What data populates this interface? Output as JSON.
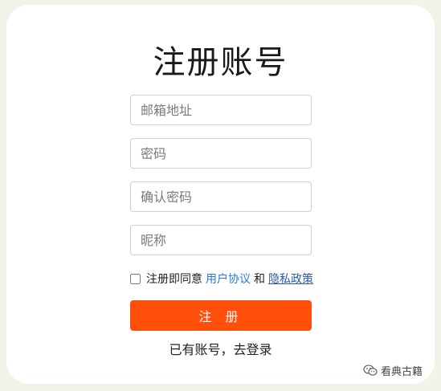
{
  "form": {
    "title": "注册账号",
    "email_placeholder": "邮箱地址",
    "password_placeholder": "密码",
    "confirm_password_placeholder": "确认密码",
    "nickname_placeholder": "昵称",
    "agree_prefix": "注册即同意",
    "user_agreement": "用户协议",
    "and_text": "和",
    "privacy_policy": "隐私政策",
    "register_button": "注 册",
    "login_link": "已有账号，去登录"
  },
  "watermark": {
    "text": "看典古籍",
    "icon": "wechat-icon"
  },
  "colors": {
    "accent": "#ff4f0b",
    "link": "#2a7bd1",
    "background": "#f3f2e9"
  }
}
